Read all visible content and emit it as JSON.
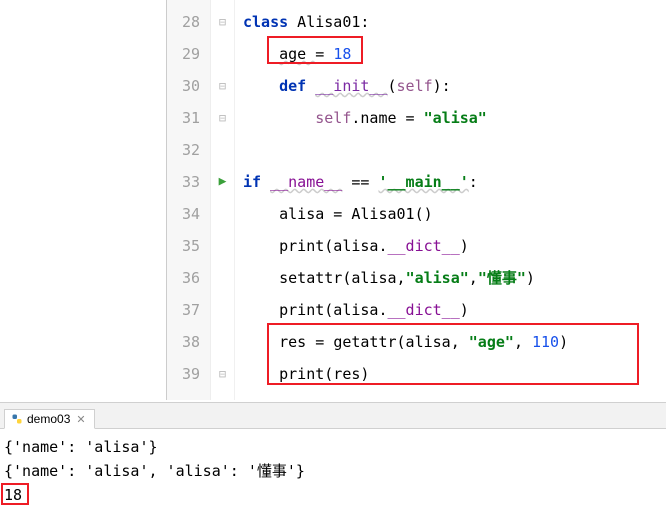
{
  "editor": {
    "lineNumbers": [
      "28",
      "29",
      "30",
      "31",
      "32",
      "33",
      "34",
      "35",
      "36",
      "37",
      "38",
      "39"
    ],
    "lines": {
      "l28": {
        "kw": "class",
        "cls": " Alisa01:"
      },
      "l29": {
        "indent": "    ",
        "id": "age ",
        "op": "= ",
        "num": "18"
      },
      "l30": {
        "indent": "    ",
        "kw": "def ",
        "fn": "__init__",
        "sig": "(",
        "self": "self",
        "sigEnd": "):"
      },
      "l31": {
        "indent": "        ",
        "self": "self",
        "attr": ".name = ",
        "str": "\"alisa\""
      },
      "l32": {
        "blank": " "
      },
      "l33": {
        "kw": "if ",
        "dunder": "__name__",
        "op": " == ",
        "str": "'__main__'",
        "end": ":"
      },
      "l34": {
        "indent": "    ",
        "id": "alisa = Alisa01()"
      },
      "l35": {
        "indent": "    ",
        "print": "print",
        "arg1": "(alisa.",
        "dunder": "__dict__",
        "arg2": ")"
      },
      "l36": {
        "indent": "    ",
        "setattr": "setattr",
        "arg1": "(alisa,",
        "str1": "\"alisa\"",
        "comma": ",",
        "str2": "\"懂事\"",
        "arg2": ")"
      },
      "l37": {
        "indent": "    ",
        "print": "print",
        "arg1": "(alisa.",
        "dunder": "__dict__",
        "arg2": ")"
      },
      "l38": {
        "indent": "    ",
        "res": "res = ",
        "getattr": "getattr",
        "arg1": "(alisa, ",
        "str": "\"age\"",
        "comma": ", ",
        "num": "110",
        "arg2": ")"
      },
      "l39": {
        "indent": "    ",
        "print": "print",
        "arg": "(res)"
      }
    }
  },
  "tab": {
    "name": "demo03"
  },
  "console": {
    "line1": "{'name': 'alisa'}",
    "line2": "{'name': 'alisa', 'alisa': '懂事'}",
    "line3": "18"
  }
}
